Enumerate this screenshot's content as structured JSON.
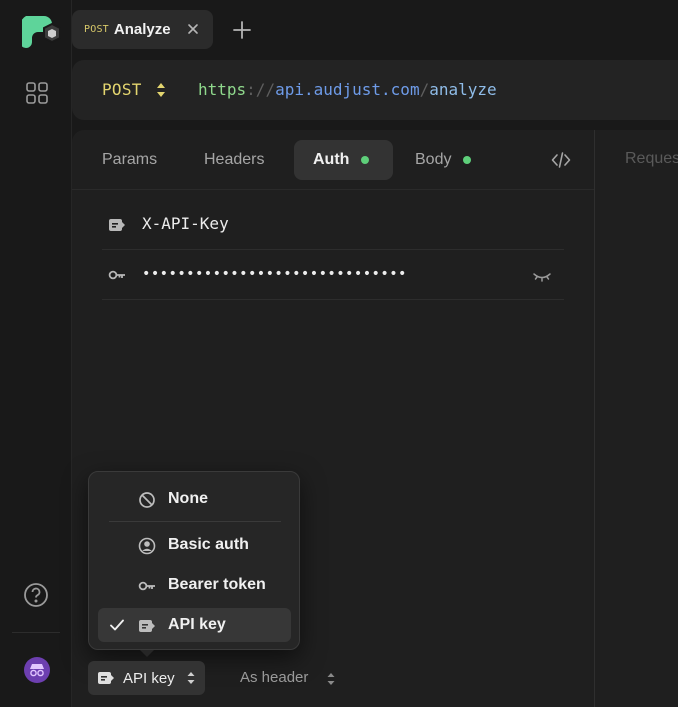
{
  "tab": {
    "method": "POST",
    "name": "Analyze"
  },
  "request": {
    "method": "POST",
    "url_scheme": "https",
    "url_sep": "://",
    "url_host": "api.audjust.com",
    "url_slash": "/",
    "url_path": "analyze"
  },
  "panel_tabs": [
    {
      "label": "Params"
    },
    {
      "label": "Headers"
    },
    {
      "label": "Auth"
    },
    {
      "label": "Body"
    }
  ],
  "response_tab": "Reques",
  "auth": {
    "key_name": "X-API-Key",
    "key_value_masked": "••••••••••••••••••••••••••••••"
  },
  "auth_menu": {
    "items": [
      {
        "label": "None",
        "icon": "ban-icon"
      },
      {
        "label": "Basic auth",
        "icon": "user-circle-icon"
      },
      {
        "label": "Bearer token",
        "icon": "key-icon"
      },
      {
        "label": "API key",
        "icon": "tag-icon",
        "selected": true
      }
    ]
  },
  "bottom": {
    "auth_type": "API key",
    "placement": "As header"
  },
  "colors": {
    "accent_green": "#5ecf7a",
    "method_yellow": "#e3d56f",
    "avatar_purple": "#6d3fb0"
  }
}
